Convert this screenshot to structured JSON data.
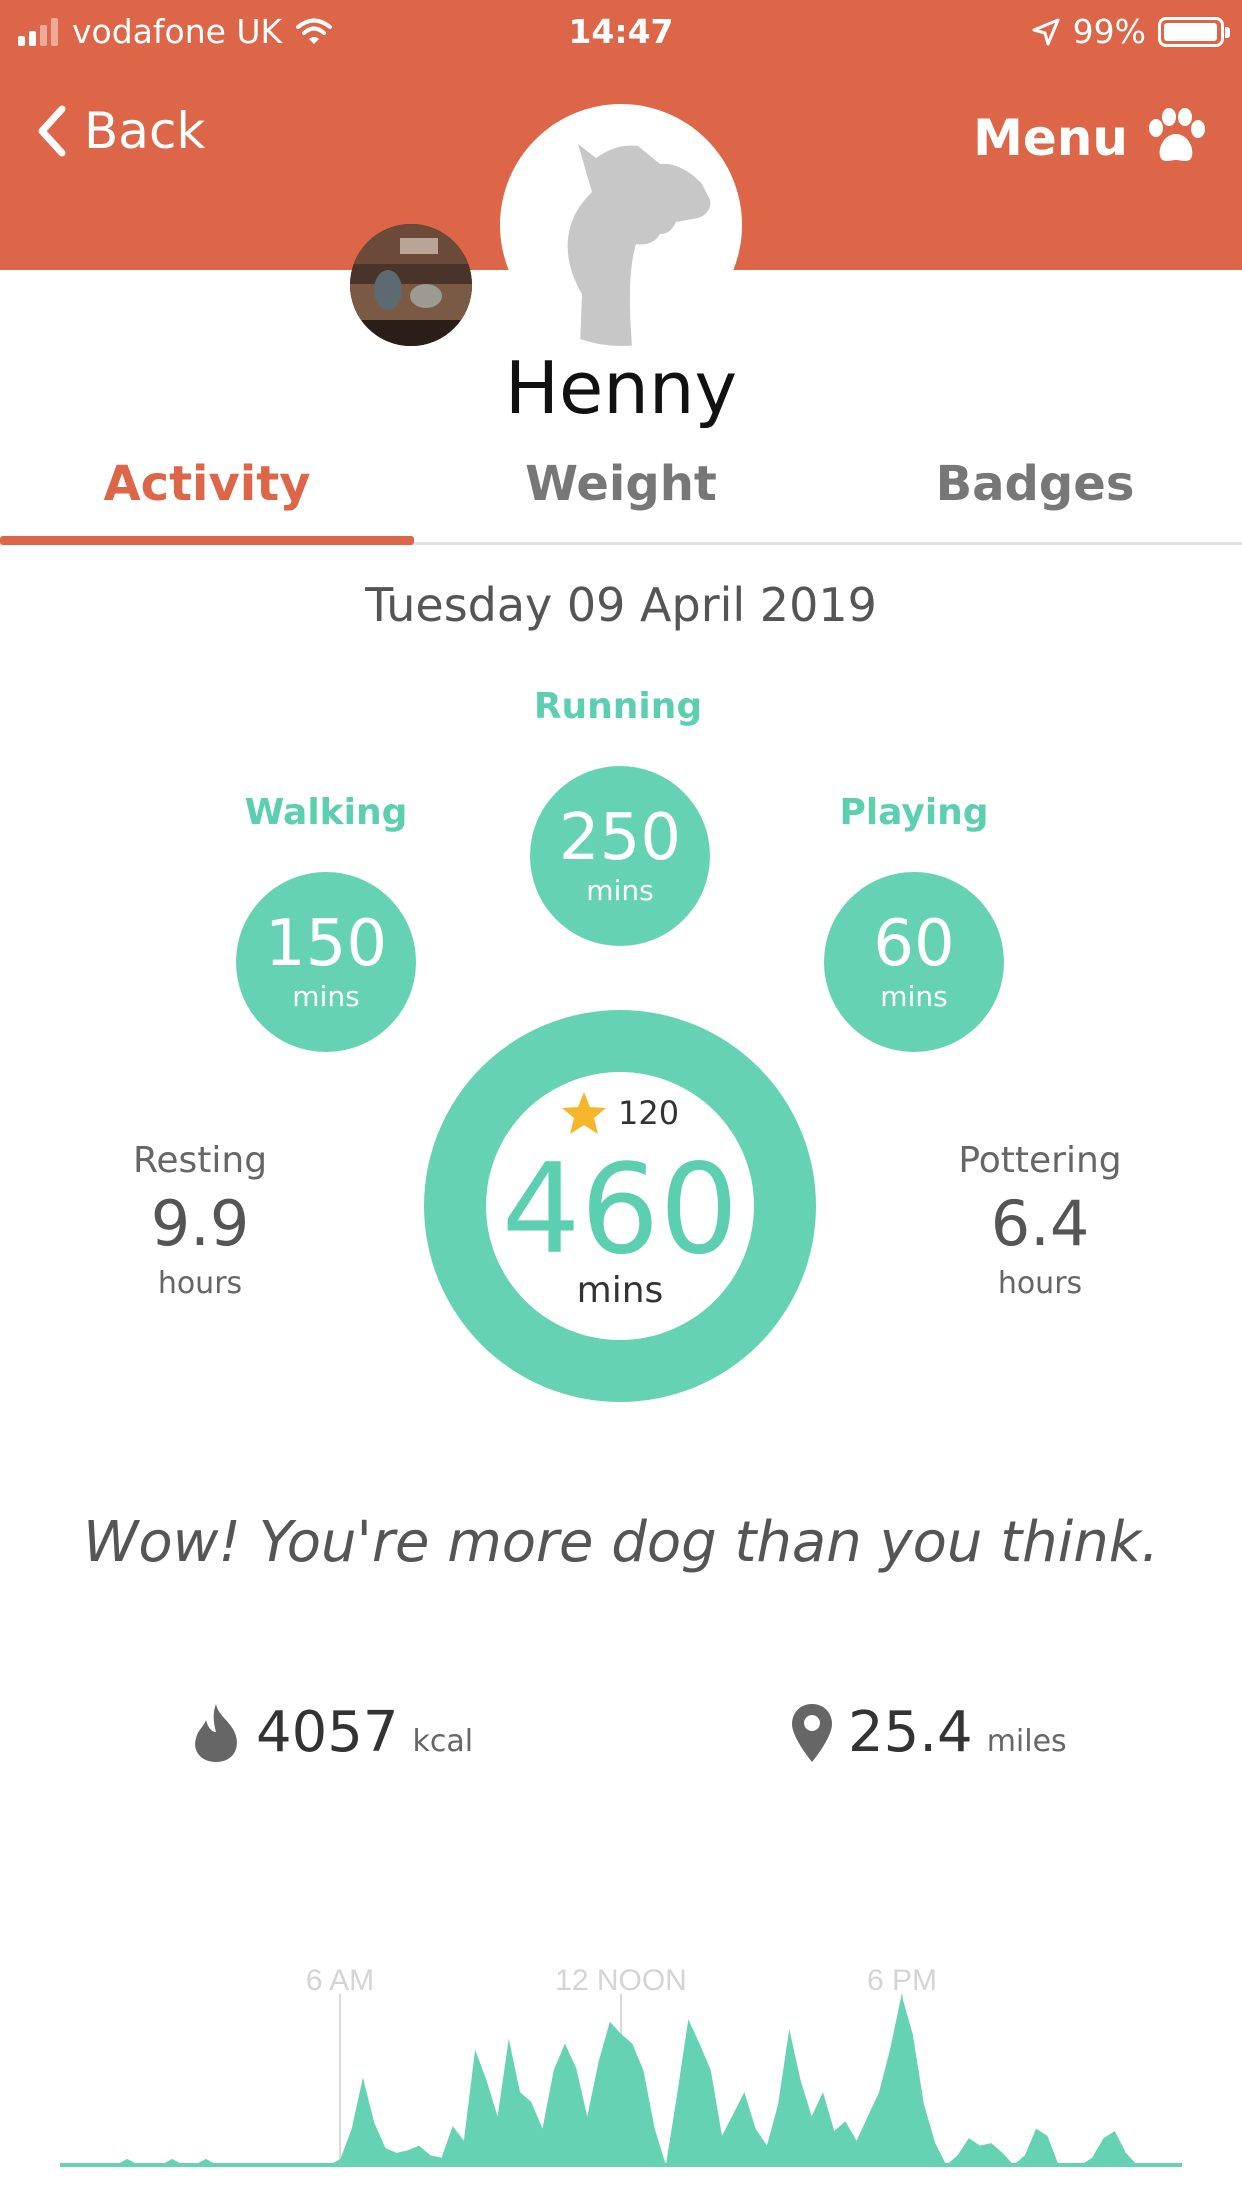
{
  "status_bar": {
    "carrier": "vodafone UK",
    "time": "14:47",
    "battery": "99%",
    "battery_level": 0.99
  },
  "header": {
    "back_label": "Back",
    "menu_label": "Menu",
    "accent_color": "#dd6648"
  },
  "profile": {
    "name": "Henny"
  },
  "tabs": [
    {
      "label": "Activity",
      "active": true
    },
    {
      "label": "Weight",
      "active": false
    },
    {
      "label": "Badges",
      "active": false
    }
  ],
  "date": "Tuesday 09 April 2019",
  "activities": {
    "running": {
      "label": "Running",
      "value": "250",
      "unit": "mins"
    },
    "walking": {
      "label": "Walking",
      "value": "150",
      "unit": "mins"
    },
    "playing": {
      "label": "Playing",
      "value": "60",
      "unit": "mins"
    },
    "resting": {
      "label": "Resting",
      "value": "9.9",
      "unit": "hours"
    },
    "pottering": {
      "label": "Pottering",
      "value": "6.4",
      "unit": "hours"
    }
  },
  "total": {
    "points": "120",
    "value": "460",
    "unit": "mins",
    "color": "#65d2b4"
  },
  "tagline": "Wow! You're more dog than you think.",
  "stats": {
    "calories": {
      "value": "4057",
      "unit": "kcal"
    },
    "distance": {
      "value": "25.4",
      "unit": "miles"
    }
  },
  "timeline": {
    "labels": [
      "6 AM",
      "12 NOON",
      "6 PM"
    ],
    "series": [
      0,
      0,
      0,
      0,
      0,
      0,
      5,
      0,
      0,
      0,
      5,
      0,
      0,
      5,
      0,
      0,
      0,
      0,
      0,
      0,
      0,
      0,
      0,
      0,
      0,
      5,
      30,
      72,
      35,
      14,
      10,
      12,
      16,
      8,
      6,
      32,
      20,
      95,
      70,
      40,
      104,
      60,
      52,
      30,
      78,
      100,
      80,
      40,
      85,
      118,
      108,
      100,
      78,
      30,
      0,
      58,
      120,
      100,
      78,
      24,
      42,
      60,
      30,
      16,
      50,
      112,
      70,
      40,
      60,
      28,
      36,
      20,
      40,
      60,
      96,
      140,
      108,
      50,
      18,
      0,
      8,
      22,
      16,
      18,
      10,
      0,
      8,
      30,
      24,
      0,
      0,
      0,
      6,
      22,
      28,
      10,
      0,
      0,
      0,
      0,
      0
    ]
  }
}
